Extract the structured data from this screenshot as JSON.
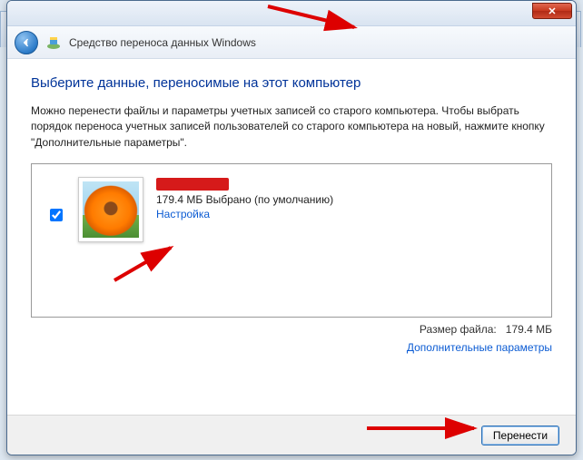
{
  "window": {
    "app_title": "Средство переноса данных Windows",
    "close_label": "✕"
  },
  "page": {
    "title": "Выберите данные, переносимые на этот компьютер",
    "description": "Можно перенести файлы и параметры учетных записей со старого компьютера. Чтобы выбрать порядок переноса учетных записей пользователей со старого компьютера на новый, нажмите кнопку \"Дополнительные параметры\"."
  },
  "item": {
    "selected_line": "179.4 МБ Выбрано (по умолчанию)",
    "customize_label": "Настройка"
  },
  "summary": {
    "file_size_label": "Размер файла:",
    "file_size_value": "179.4 МБ",
    "advanced_label": "Дополнительные параметры"
  },
  "footer": {
    "transfer_label": "Перенести"
  }
}
